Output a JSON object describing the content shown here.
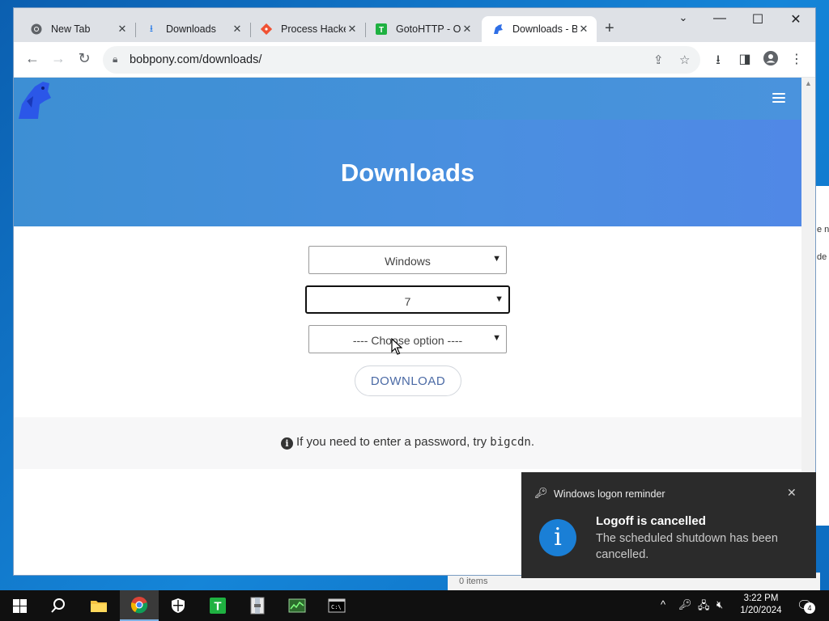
{
  "browser": {
    "tabs": [
      {
        "title": "New Tab",
        "icon": "chrome-icon"
      },
      {
        "title": "Downloads",
        "icon": "download-icon"
      },
      {
        "title": "Process Hacke",
        "icon": "git-icon"
      },
      {
        "title": "GotoHTTP - O",
        "icon": "gotohttp-icon"
      },
      {
        "title": "Downloads - B",
        "icon": "bobpony-icon",
        "active": true
      }
    ],
    "url": "bobpony.com/downloads/"
  },
  "page": {
    "heading": "Downloads",
    "selects": {
      "os": "Windows",
      "version": "7",
      "option": "---- Choose option ----"
    },
    "download_button": "DOWNLOAD",
    "info_prefix": "If you need to enter a password, try ",
    "info_code": "bigcdn",
    "info_suffix": "."
  },
  "toast": {
    "app": "Windows logon reminder",
    "title": "Logoff is cancelled",
    "body": "The scheduled shutdown has been cancelled."
  },
  "background": {
    "explorer_status": "0 items",
    "side_text_1": "e n",
    "side_text_2": "de"
  },
  "taskbar": {
    "time": "3:22 PM",
    "date": "1/20/2024",
    "notification_count": "4"
  }
}
